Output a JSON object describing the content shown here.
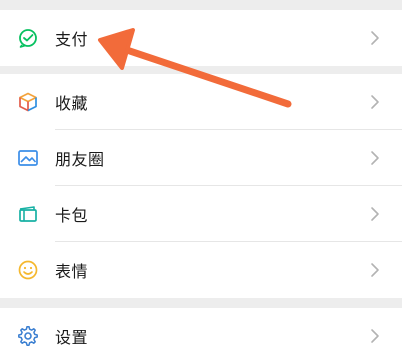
{
  "colors": {
    "background": "#ededed",
    "row": "#ffffff",
    "text": "#1a1a1a",
    "chevron": "#b3b3b3",
    "pay_icon": "#07c160",
    "favorites_icon_top": "#f3a33b",
    "favorites_icon_side": "#2f8fe0",
    "moments_icon": "#3b8ee8",
    "cards_icon": "#17b1a4",
    "stickers_icon": "#f5b82e",
    "settings_icon": "#3b7fd1",
    "annotation_arrow": "#f26b3a"
  },
  "menu": {
    "pay": {
      "label": "支付",
      "icon": "wechat-pay-icon"
    },
    "favorites": {
      "label": "收藏",
      "icon": "cube-icon"
    },
    "moments": {
      "label": "朋友圈",
      "icon": "picture-icon"
    },
    "cards": {
      "label": "卡包",
      "icon": "card-wallet-icon"
    },
    "stickers": {
      "label": "表情",
      "icon": "smiley-icon"
    },
    "settings": {
      "label": "设置",
      "icon": "gear-icon"
    }
  },
  "annotation": {
    "type": "arrow",
    "points_to": "pay",
    "icon": "arrow-icon"
  }
}
